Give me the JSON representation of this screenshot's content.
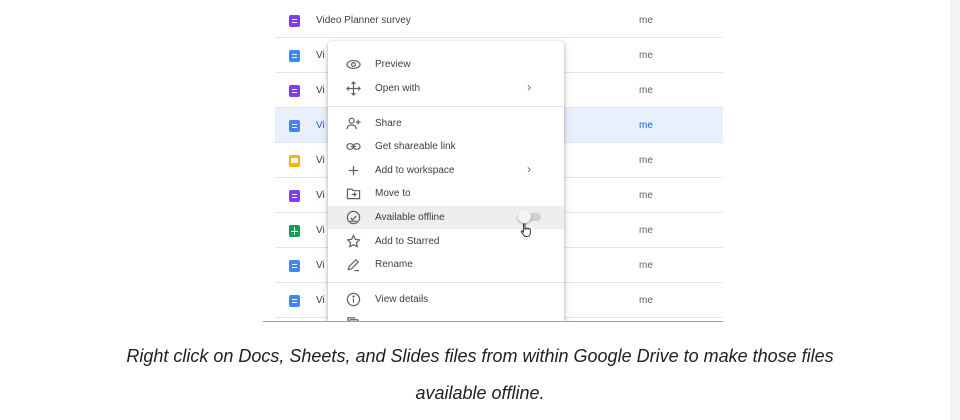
{
  "file_list": {
    "rows": [
      {
        "name": "Video Planner survey",
        "type": "forms",
        "owner": "me",
        "selected": false
      },
      {
        "name": "Vi",
        "type": "docs",
        "owner": "me",
        "selected": false
      },
      {
        "name": "Vi",
        "type": "forms",
        "owner": "me",
        "selected": false
      },
      {
        "name": "Vi",
        "type": "docs",
        "owner": "me",
        "selected": true
      },
      {
        "name": "Vi",
        "type": "slides",
        "owner": "me",
        "selected": false
      },
      {
        "name": "Vi",
        "type": "forms",
        "owner": "me",
        "selected": false
      },
      {
        "name": "Vi",
        "type": "sheets",
        "owner": "me",
        "selected": false
      },
      {
        "name": "Vi",
        "type": "docs",
        "owner": "me",
        "selected": false
      },
      {
        "name": "Vi",
        "type": "docs",
        "owner": "me",
        "selected": false
      }
    ]
  },
  "context_menu": {
    "items": [
      {
        "label": "Preview",
        "icon": "eye-icon"
      },
      {
        "label": "Open with",
        "icon": "move-arrows-icon",
        "submenu": true
      },
      {
        "label": "Share",
        "icon": "add-person-icon"
      },
      {
        "label": "Get shareable link",
        "icon": "link-icon"
      },
      {
        "label": "Add to workspace",
        "icon": "plus-icon",
        "submenu": true
      },
      {
        "label": "Move to",
        "icon": "folder-move-icon"
      },
      {
        "label": "Available offline",
        "icon": "offline-check-icon",
        "toggle": "off",
        "hovered": true
      },
      {
        "label": "Add to Starred",
        "icon": "star-icon"
      },
      {
        "label": "Rename",
        "icon": "pencil-icon"
      },
      {
        "label": "View details",
        "icon": "info-icon"
      }
    ],
    "submenu_arrow": "›"
  },
  "caption": {
    "line1": "Right click on Docs, Sheets, and Slides files from within Google Drive to make those files",
    "line2": "available offline."
  },
  "colors": {
    "docs": "#4285f4",
    "forms": "#7e3ff2",
    "slides": "#f4b400",
    "sheets": "#0f9d58",
    "selection": "#e8f0fe"
  }
}
